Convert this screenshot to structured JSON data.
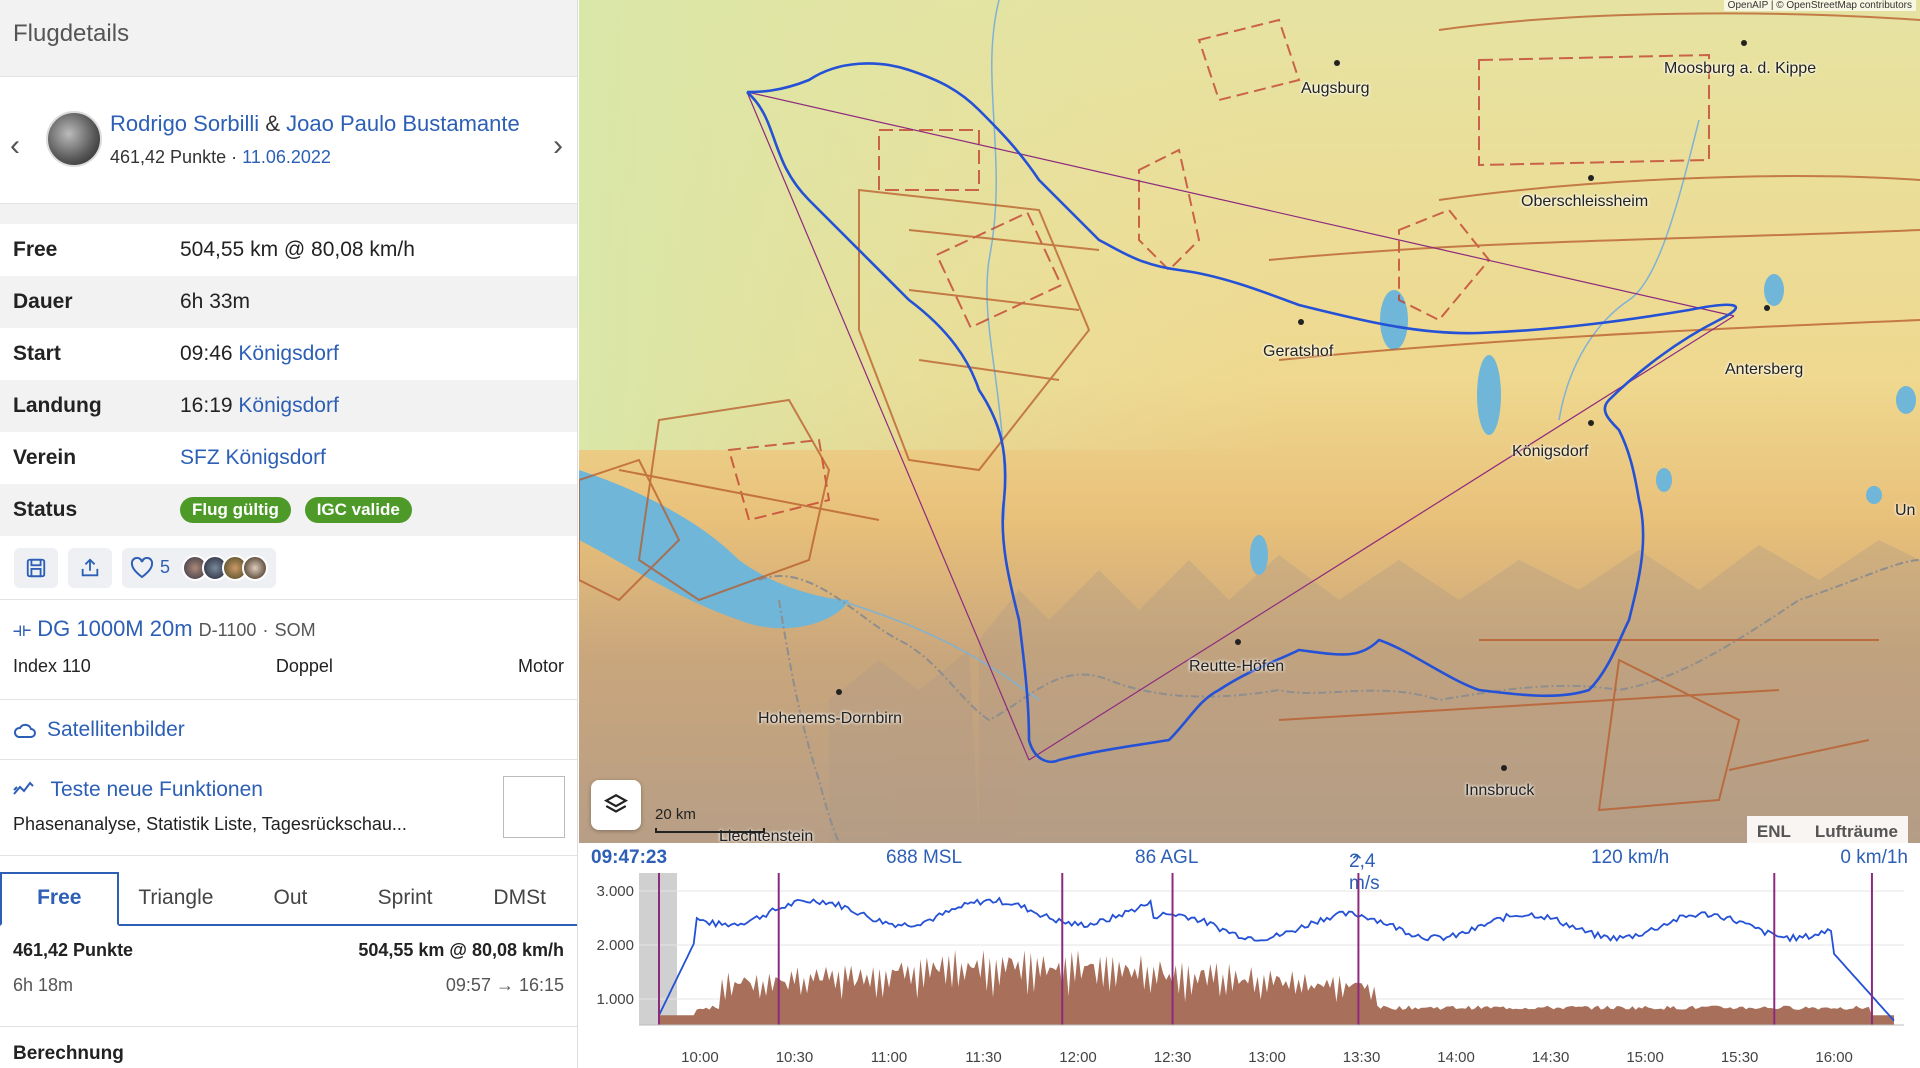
{
  "panel": {
    "title": "Flugdetails"
  },
  "pilot": {
    "name1": "Rodrigo Sorbilli",
    "amp": "&",
    "name2": "Joao Paulo Bustamante",
    "points": "461,42 Punkte",
    "sep": "·",
    "date": "11.06.2022"
  },
  "details": [
    {
      "key": "Free",
      "value": "504,55 km @ 80,08 km/h"
    },
    {
      "key": "Dauer",
      "value": "6h 33m"
    },
    {
      "key": "Start",
      "time": "09:46",
      "link": "Königsdorf"
    },
    {
      "key": "Landung",
      "time": "16:19",
      "link": "Königsdorf"
    },
    {
      "key": "Verein",
      "link": "SFZ Königsdorf"
    },
    {
      "key": "Status",
      "badges": [
        "Flug gültig",
        "IGC valide"
      ]
    }
  ],
  "actions": {
    "likes": "5"
  },
  "plane": {
    "name": "DG 1000M 20m",
    "reg": "D-1100",
    "dot": "·",
    "callsign": "SOM",
    "index": "Index 110",
    "seats": "Doppel",
    "engine": "Motor"
  },
  "satellite": {
    "label": "Satellitenbilder"
  },
  "features": {
    "title": "Teste neue Funktionen",
    "subtitle": "Phasenanalyse, Statistik Liste, Tagesrückschau..."
  },
  "tabs": [
    "Free",
    "Triangle",
    "Out",
    "Sprint",
    "DMSt"
  ],
  "result": {
    "points": "461,42 Punkte",
    "dist": "504,55 km @ 80,08 km/h",
    "duration": "6h 18m",
    "times": "09:57 → 16:15",
    "section": "Berechnung"
  },
  "map": {
    "attribution": "OpenAIP | © OpenStreetMap contributors",
    "scale": "20 km",
    "toggles": [
      "ENL",
      "Lufträume"
    ],
    "places": [
      "Augsburg",
      "Moosburg a. d. Kippe",
      "Oberschleissheim",
      "Geratshof",
      "Antersberg",
      "Königsdorf",
      "Reutte-Höfen",
      "Hohenems-Dornbirn",
      "Innsbruck",
      "Liechtenstein",
      "Un"
    ],
    "colors": {
      "track": "#2451d6",
      "task": "#8e2a7e",
      "airspace": "#c0392b"
    }
  },
  "barogram": {
    "time": "09:47:23",
    "msl": "688 MSL",
    "agl": "86 AGL",
    "vario": "2,4 m/s",
    "speed": "120 km/h",
    "enl": "0 km/1h",
    "yticks": [
      "3.000",
      "2.000",
      "1.000"
    ],
    "xticks": [
      "10:00",
      "10:30",
      "11:00",
      "11:30",
      "12:00",
      "12:30",
      "13:00",
      "13:30",
      "14:00",
      "14:30",
      "15:00",
      "15:30",
      "16:00"
    ]
  }
}
